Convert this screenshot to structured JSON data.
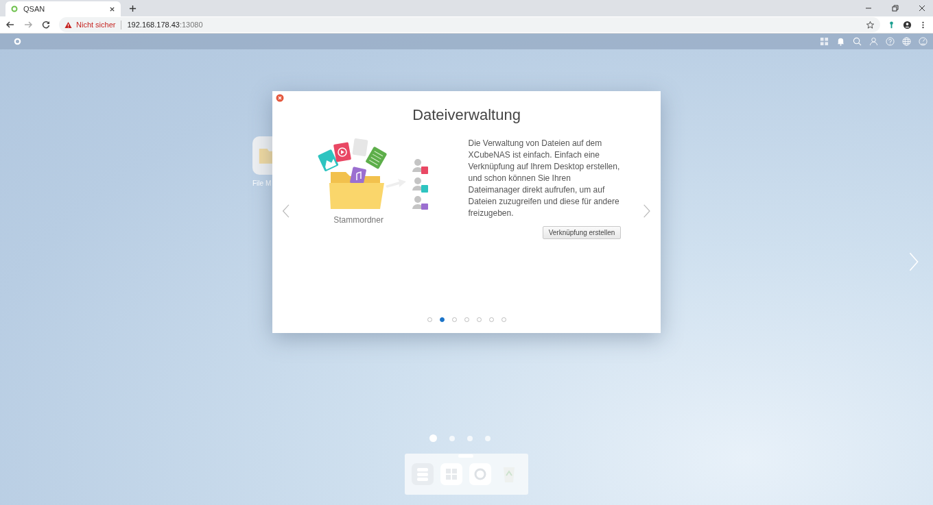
{
  "browser": {
    "tab": {
      "title": "QSAN"
    },
    "security": "Nicht sicher",
    "url_host": "192.168.178.43",
    "url_port": ":13080"
  },
  "desktop": {
    "icon_label": "File M",
    "pages": [
      {
        "selected": true
      },
      {
        "selected": false
      },
      {
        "selected": false
      },
      {
        "selected": false
      }
    ]
  },
  "dialog": {
    "title": "Dateiverwaltung",
    "caption": "Stammordner",
    "text": "Die Verwaltung von Dateien auf dem XCubeNAS ist einfach. Einfach eine Verknüpfung auf Ihrem Desktop erstellen, und schon können Sie Ihren Dateimanager direkt aufrufen, um auf Dateien zuzugreifen und diese für andere freizugeben.",
    "button": "Verknüpfung erstellen",
    "slides": [
      {
        "selected": false
      },
      {
        "selected": true
      },
      {
        "selected": false
      },
      {
        "selected": false
      },
      {
        "selected": false
      },
      {
        "selected": false
      },
      {
        "selected": false
      }
    ]
  }
}
